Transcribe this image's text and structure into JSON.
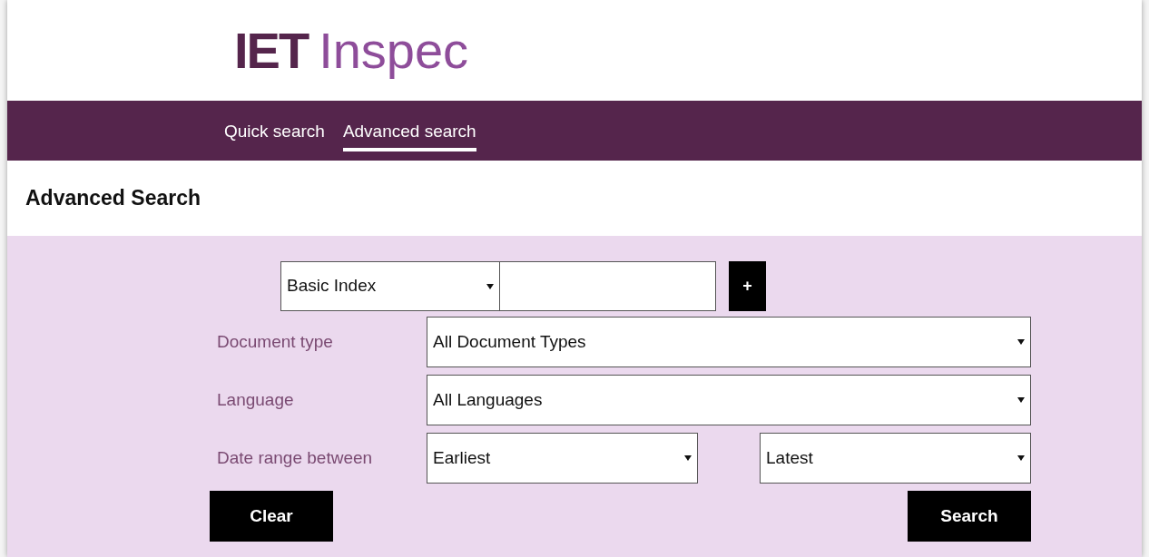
{
  "logo": {
    "mark": "IET",
    "name": "Inspec"
  },
  "nav": [
    {
      "label": "Quick search",
      "selected": false
    },
    {
      "label": "Advanced search",
      "selected": true
    }
  ],
  "page_title": "Advanced Search",
  "query_row": {
    "index_select": "Basic Index",
    "add_button": "+"
  },
  "fields": [
    {
      "label": "Document type",
      "selects": [
        "All Document Types"
      ]
    },
    {
      "label": "Language",
      "selects": [
        "All Languages"
      ]
    },
    {
      "label": "Date range between",
      "selects": [
        "Earliest",
        "Latest"
      ]
    }
  ],
  "buttons": {
    "clear": "Clear",
    "search": "Search"
  }
}
